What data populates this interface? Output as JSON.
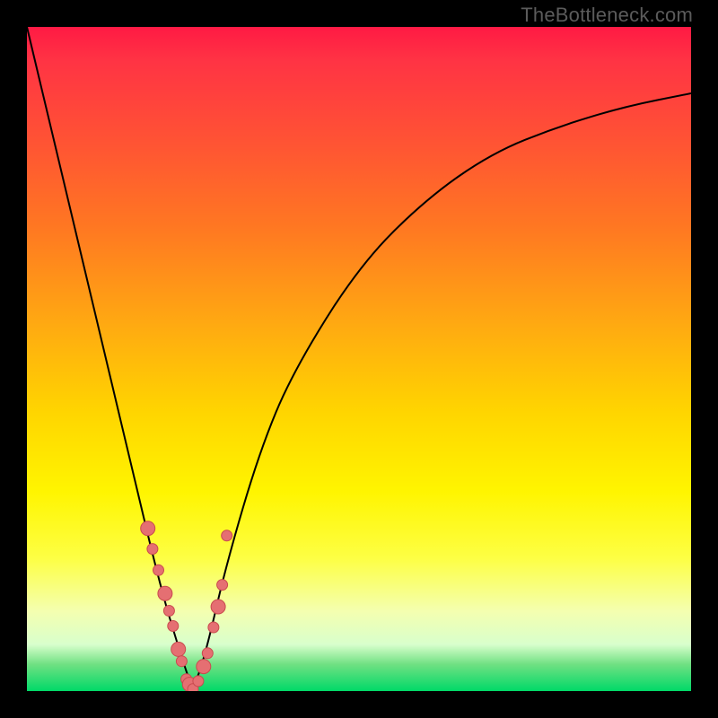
{
  "watermark": "TheBottleneck.com",
  "colors": {
    "background": "#000000",
    "gradient_top": "#ff1a44",
    "gradient_mid": "#ffd500",
    "gradient_bottom": "#00d968",
    "curve": "#000000",
    "marker_fill": "#e56f72",
    "marker_stroke": "#c94a4e"
  },
  "chart_data": {
    "type": "line",
    "title": "",
    "xlabel": "",
    "ylabel": "",
    "curve": {
      "x": [
        0.0,
        0.05,
        0.1,
        0.15,
        0.2,
        0.23,
        0.25,
        0.27,
        0.3,
        0.35,
        0.4,
        0.5,
        0.6,
        0.7,
        0.8,
        0.9,
        1.0
      ],
      "y": [
        1.0,
        0.79,
        0.58,
        0.37,
        0.16,
        0.06,
        0.0,
        0.06,
        0.19,
        0.36,
        0.48,
        0.64,
        0.74,
        0.81,
        0.85,
        0.88,
        0.9
      ]
    },
    "markers": {
      "x": [
        0.182,
        0.189,
        0.198,
        0.208,
        0.214,
        0.22,
        0.228,
        0.233,
        0.24,
        0.245,
        0.25,
        0.258,
        0.266,
        0.272,
        0.281,
        0.288,
        0.294,
        0.301
      ],
      "y": [
        0.245,
        0.214,
        0.182,
        0.147,
        0.121,
        0.098,
        0.063,
        0.045,
        0.018,
        0.01,
        0.003,
        0.015,
        0.037,
        0.057,
        0.096,
        0.127,
        0.16,
        0.234
      ]
    },
    "xlim": [
      0,
      1
    ],
    "ylim": [
      0,
      1
    ],
    "legend": false,
    "grid": false
  }
}
